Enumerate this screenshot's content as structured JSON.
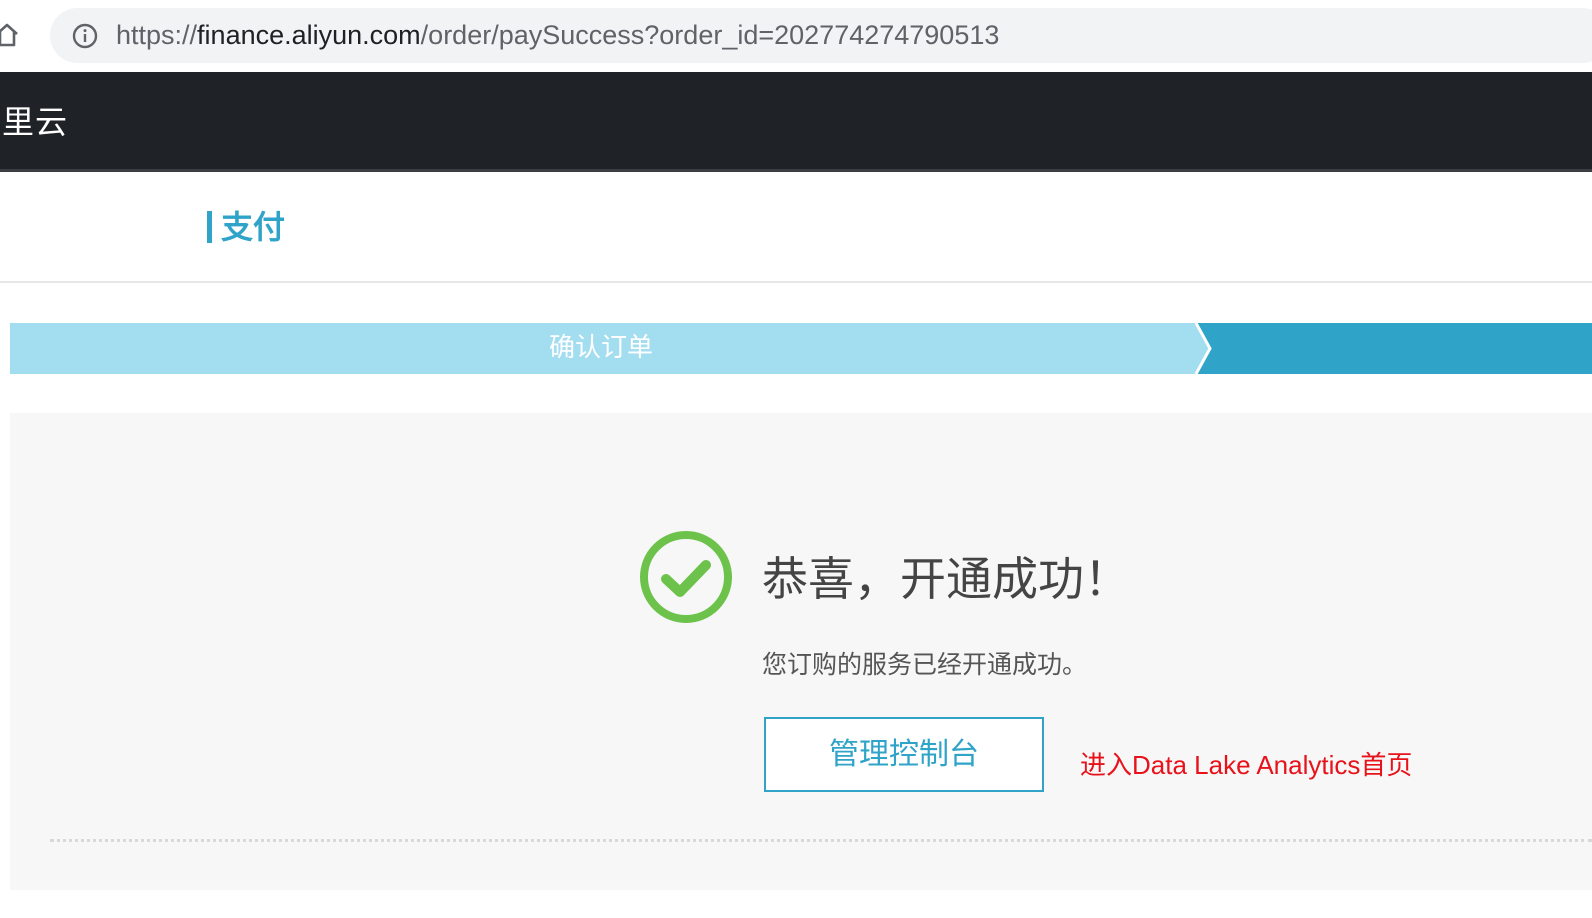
{
  "browser": {
    "url_scheme": "https://",
    "url_host": "finance.aliyun.com",
    "url_path": "/order/paySuccess?order_id=202774274790513",
    "home_icon": "home-icon",
    "info_icon": "info-icon"
  },
  "header": {
    "brand": "里云"
  },
  "section": {
    "title": "支付"
  },
  "steps": {
    "items": [
      {
        "label": "确认订单",
        "state": "done"
      },
      {
        "label": "",
        "state": "current"
      }
    ]
  },
  "result": {
    "icon": "check-circle-icon",
    "title": "恭喜，开通成功！",
    "description": "您订购的服务已经开通成功。",
    "console_button_label": "管理控制台",
    "annotation": "进入Data Lake Analytics首页"
  },
  "colors": {
    "accent": "#2fa3c8",
    "step_done": "#a3ddf0",
    "step_current": "#2fa3c8",
    "success": "#6cc24a",
    "annotation": "#e8121b",
    "header_bg": "#1f2227"
  }
}
